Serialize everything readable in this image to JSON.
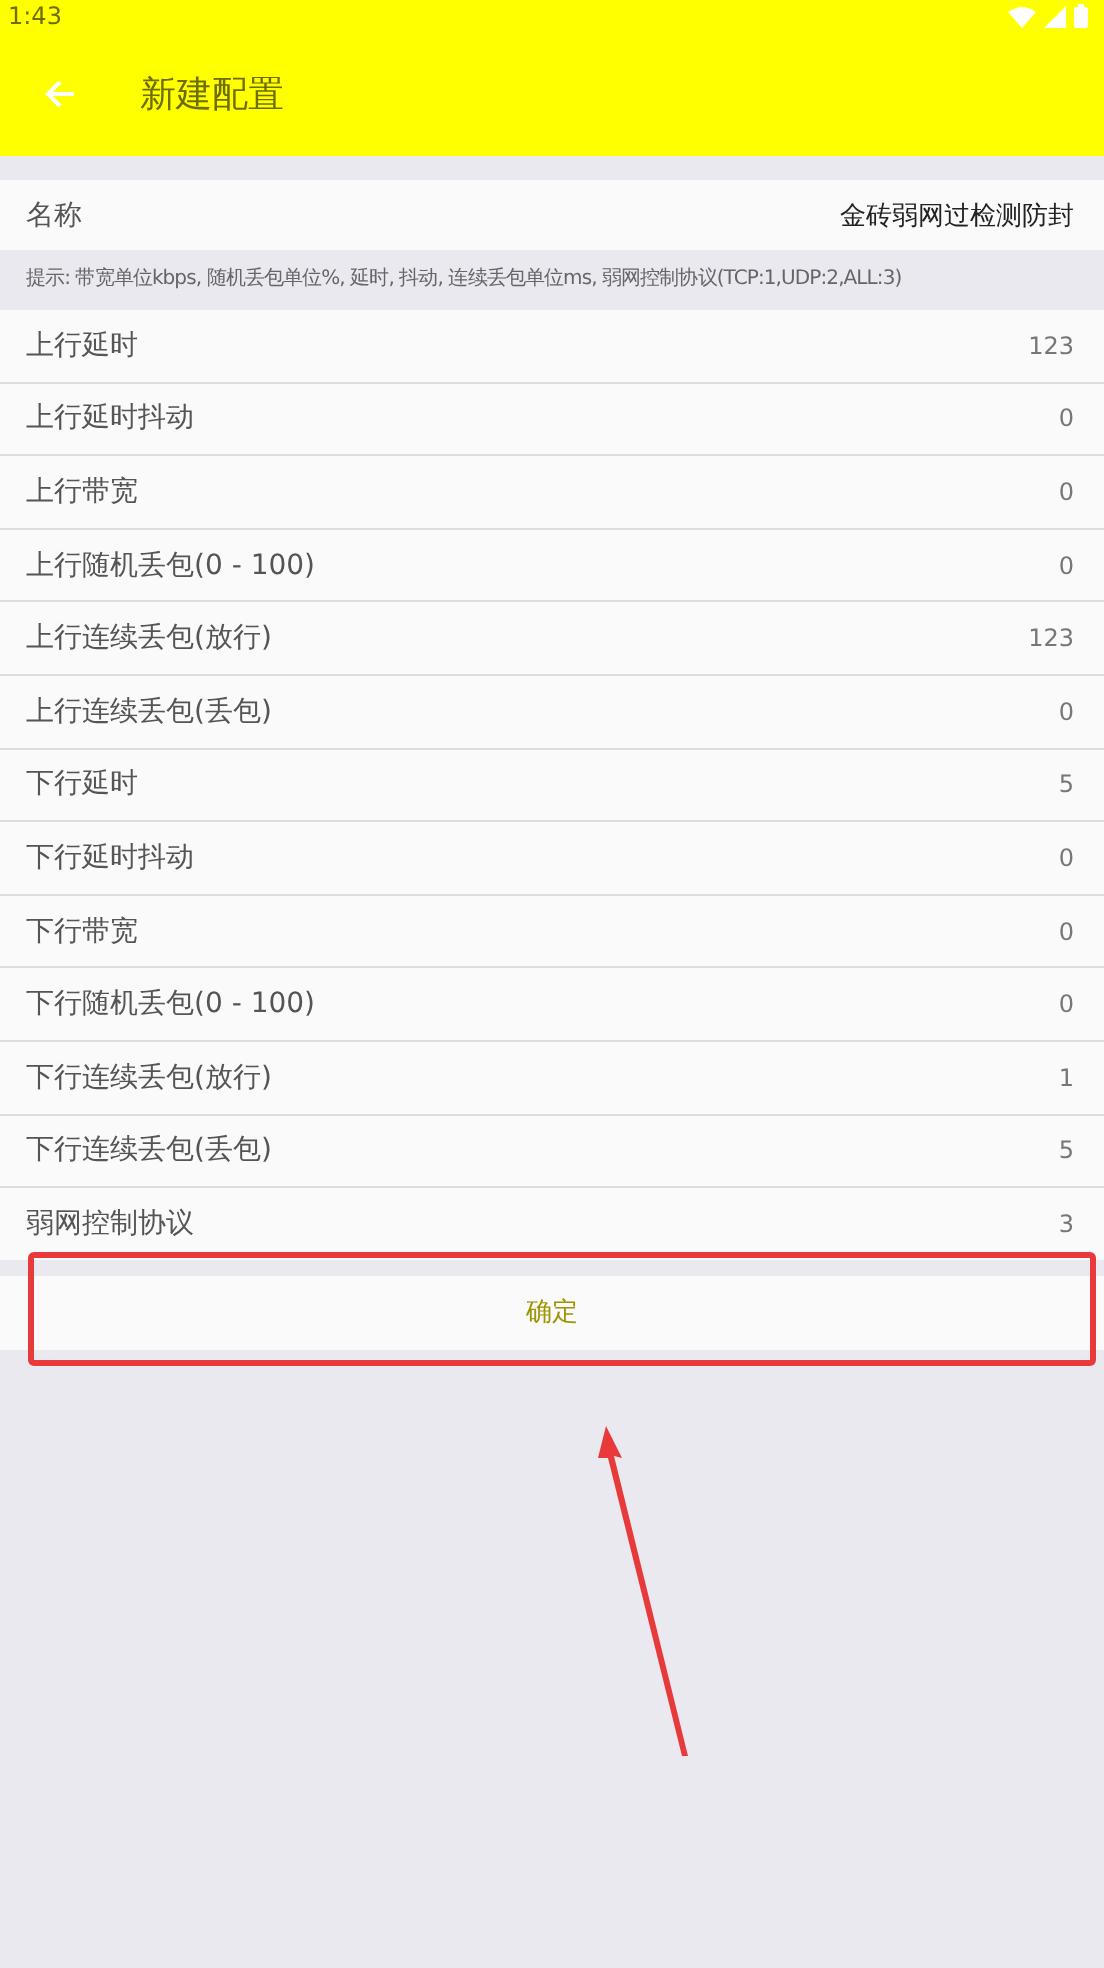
{
  "status_bar": {
    "time": "1:43"
  },
  "app_bar": {
    "title": "新建配置"
  },
  "name_field": {
    "label": "名称",
    "value": "金砖弱网过检测防封"
  },
  "hint": "提示: 带宽单位kbps, 随机丢包单位%, 延时, 抖动, 连续丢包单位ms, 弱网控制协议(TCP:1,UDP:2,ALL:3)",
  "settings": [
    {
      "label": "上行延时",
      "value": "123"
    },
    {
      "label": "上行延时抖动",
      "value": "0"
    },
    {
      "label": "上行带宽",
      "value": "0"
    },
    {
      "label": "上行随机丢包(0 - 100)",
      "value": "0"
    },
    {
      "label": "上行连续丢包(放行)",
      "value": "123"
    },
    {
      "label": "上行连续丢包(丢包)",
      "value": "0"
    },
    {
      "label": "下行延时",
      "value": "5"
    },
    {
      "label": "下行延时抖动",
      "value": "0"
    },
    {
      "label": "下行带宽",
      "value": "0"
    },
    {
      "label": "下行随机丢包(0 - 100)",
      "value": "0"
    },
    {
      "label": "下行连续丢包(放行)",
      "value": "1"
    },
    {
      "label": "下行连续丢包(丢包)",
      "value": "5"
    },
    {
      "label": "弱网控制协议",
      "value": "3"
    }
  ],
  "confirm_button": "确定"
}
